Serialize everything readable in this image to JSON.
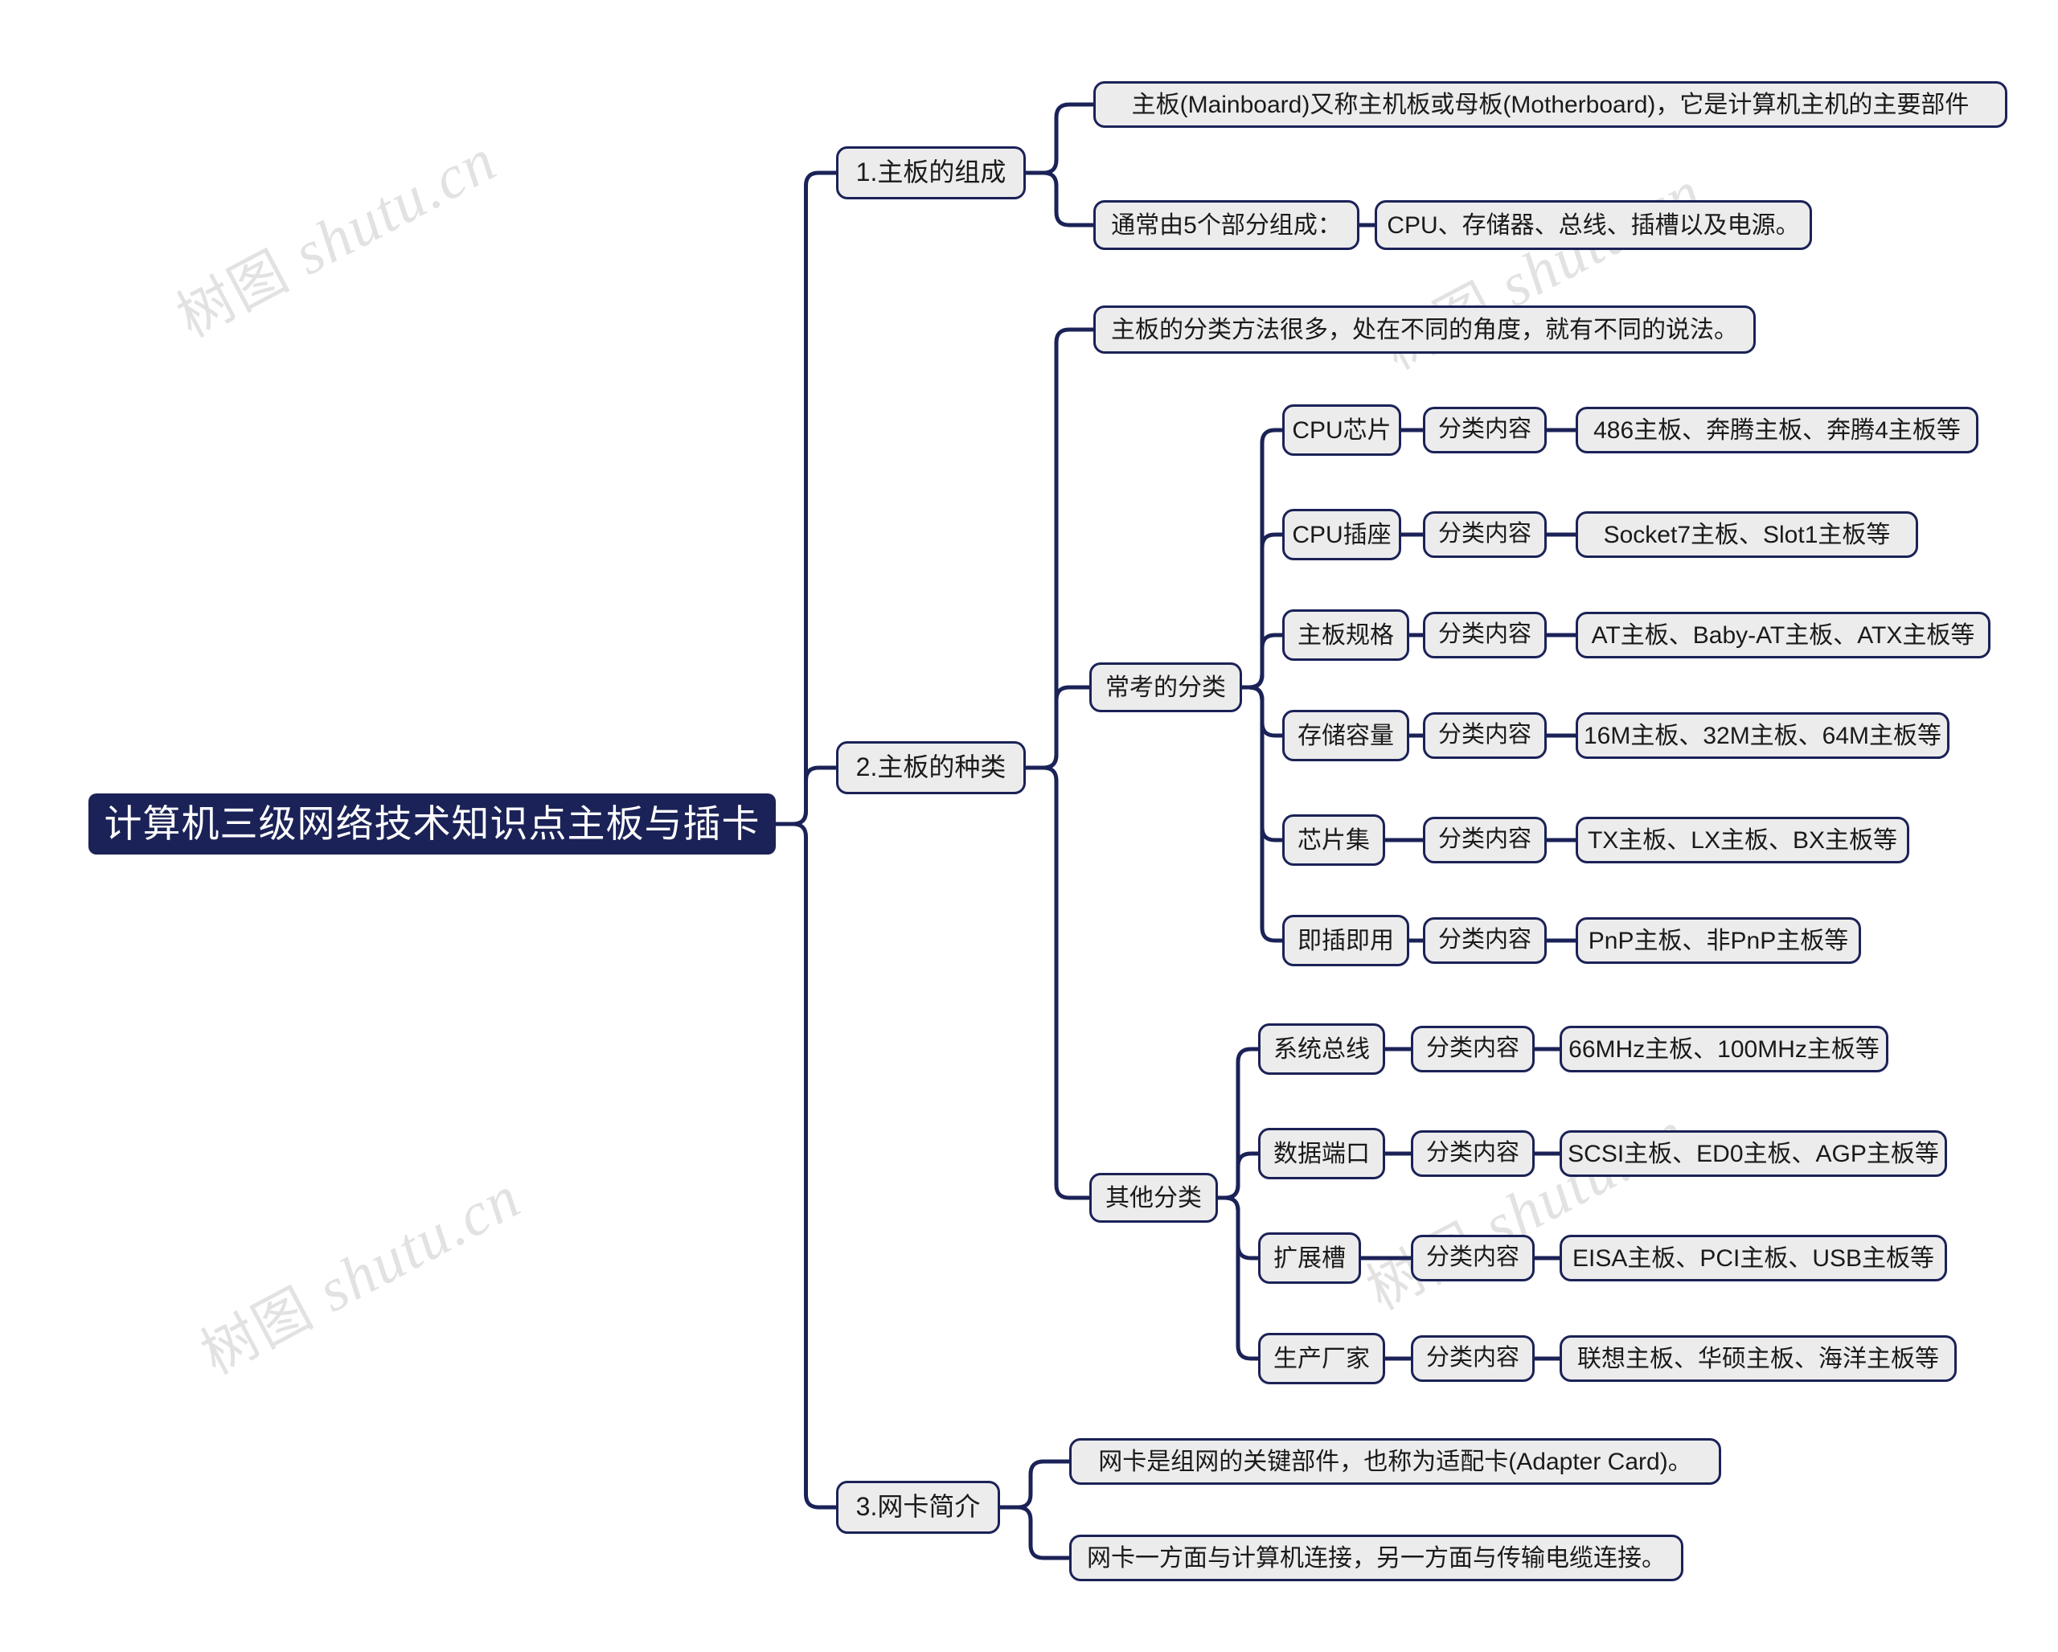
{
  "meta": {
    "watermark_text": "树图 shutu.cn",
    "accent_navy": "#1b2257",
    "node_fill": "#ececec",
    "node_border": "#1b2257",
    "background": "#ffffff"
  },
  "root": {
    "label": "计算机三级网络技术知识点主板与插卡"
  },
  "branches": [
    {
      "label": "1.主板的组成",
      "children": [
        {
          "label": "主板(Mainboard)又称主机板或母板(Motherboard)，它是计算机主机的主要部件"
        },
        {
          "label": "通常由5个部分组成：",
          "children": [
            {
              "label": "CPU、存储器、总线、插槽以及电源。"
            }
          ]
        }
      ]
    },
    {
      "label": "2.主板的种类",
      "children": [
        {
          "label": "主板的分类方法很多，处在不同的角度，就有不同的说法。"
        },
        {
          "label": "常考的分类",
          "rows": [
            {
              "key": "CPU芯片",
              "tag": "分类内容",
              "value": "486主板、奔腾主板、奔腾4主板等"
            },
            {
              "key": "CPU插座",
              "tag": "分类内容",
              "value": "Socket7主板、Slot1主板等"
            },
            {
              "key": "主板规格",
              "tag": "分类内容",
              "value": "AT主板、Baby-AT主板、ATX主板等"
            },
            {
              "key": "存储容量",
              "tag": "分类内容",
              "value": "16M主板、32M主板、64M主板等"
            },
            {
              "key": "芯片集",
              "tag": "分类内容",
              "value": "TX主板、LX主板、BX主板等"
            },
            {
              "key": "即插即用",
              "tag": "分类内容",
              "value": "PnP主板、非PnP主板等"
            }
          ]
        },
        {
          "label": "其他分类",
          "rows": [
            {
              "key": "系统总线",
              "tag": "分类内容",
              "value": "66MHz主板、100MHz主板等"
            },
            {
              "key": "数据端口",
              "tag": "分类内容",
              "value": "SCSI主板、ED0主板、AGP主板等"
            },
            {
              "key": "扩展槽",
              "tag": "分类内容",
              "value": "EISA主板、PCI主板、USB主板等"
            },
            {
              "key": "生产厂家",
              "tag": "分类内容",
              "value": "联想主板、华硕主板、海洋主板等"
            }
          ]
        }
      ]
    },
    {
      "label": "3.网卡简介",
      "children": [
        {
          "label": "网卡是组网的关键部件，也称为适配卡(Adapter Card)。"
        },
        {
          "label": "网卡一方面与计算机连接，另一方面与传输电缆连接。"
        }
      ]
    }
  ]
}
